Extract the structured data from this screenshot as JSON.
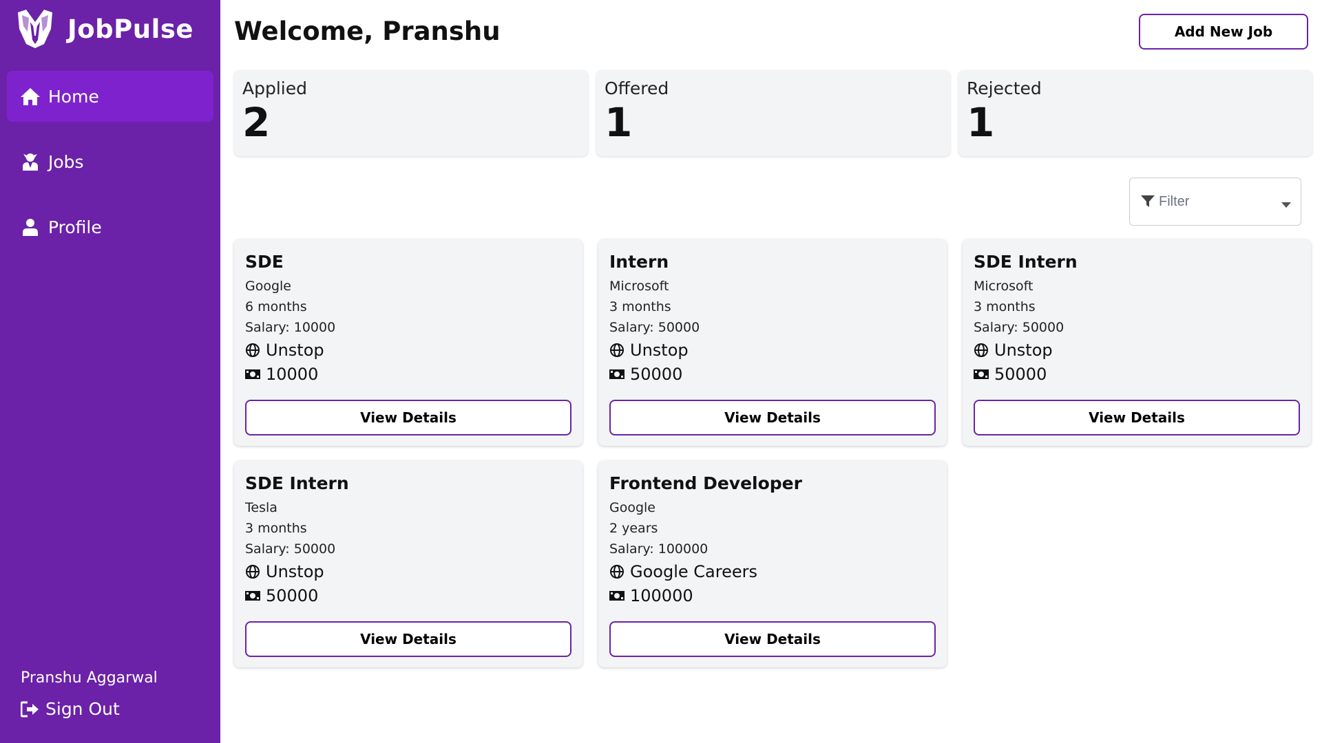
{
  "brand": {
    "name": "JobPulse",
    "logo_icon": "tuxedo-logo-icon"
  },
  "nav": {
    "items": [
      {
        "label": "Home",
        "icon": "home-icon"
      },
      {
        "label": "Jobs",
        "icon": "user-tie-icon"
      },
      {
        "label": "Profile",
        "icon": "user-icon"
      }
    ],
    "active": "Home"
  },
  "user": {
    "name": "Pranshu Aggarwal",
    "signout_label": "Sign Out"
  },
  "header": {
    "title": "Welcome, Pranshu",
    "add_button": "Add New Job"
  },
  "stats": [
    {
      "label": "Applied",
      "value": "2"
    },
    {
      "label": "Offered",
      "value": "1"
    },
    {
      "label": "Rejected",
      "value": "1"
    }
  ],
  "filter": {
    "placeholder": "Filter"
  },
  "jobs": [
    {
      "title": "SDE",
      "company": "Google",
      "duration": "6 months",
      "salary_line": "Salary: 10000",
      "platform": "Unstop",
      "amount": "10000",
      "button": "View Details"
    },
    {
      "title": "Intern",
      "company": "Microsoft",
      "duration": "3 months",
      "salary_line": "Salary: 50000",
      "platform": "Unstop",
      "amount": "50000",
      "button": "View Details"
    },
    {
      "title": "SDE Intern",
      "company": "Microsoft",
      "duration": "3 months",
      "salary_line": "Salary: 50000",
      "platform": "Unstop",
      "amount": "50000",
      "button": "View Details"
    },
    {
      "title": "SDE Intern",
      "company": "Tesla",
      "duration": "3 months",
      "salary_line": "Salary: 50000",
      "platform": "Unstop",
      "amount": "50000",
      "button": "View Details"
    },
    {
      "title": "Frontend Developer",
      "company": "Google",
      "duration": "2 years",
      "salary_line": "Salary: 100000",
      "platform": "Google Careers",
      "amount": "100000",
      "button": "View Details"
    }
  ],
  "colors": {
    "sidebar": "#6b21a8",
    "active_nav": "#7e22ce",
    "card_bg": "#f3f4f6",
    "button_border": "#6b21a8"
  }
}
